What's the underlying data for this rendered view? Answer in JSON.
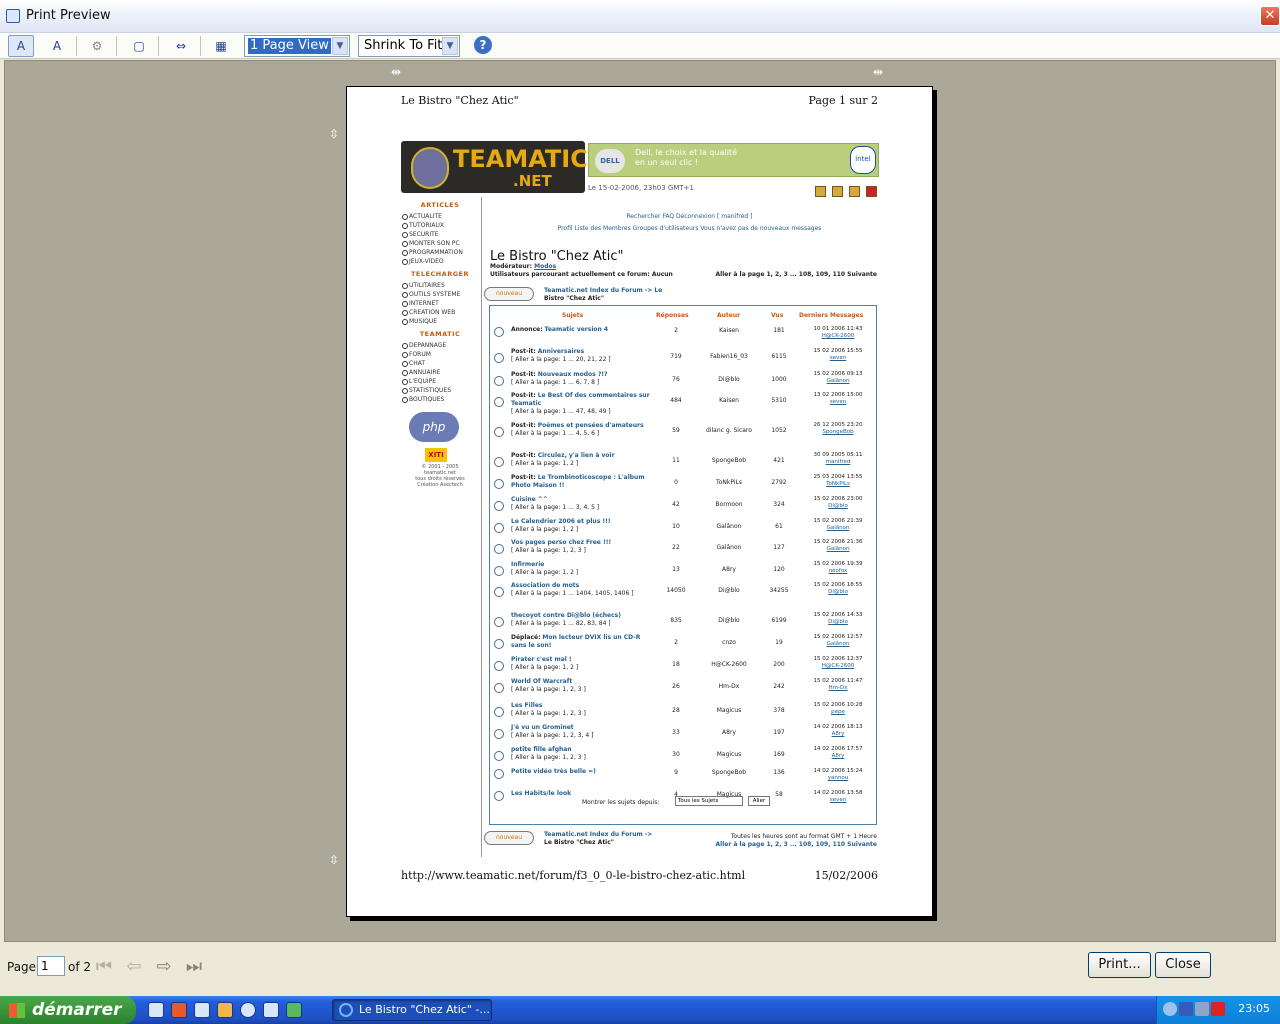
{
  "window": {
    "title": "Print Preview",
    "close_glyph": "✕"
  },
  "toolbar": {
    "view_mode": "1 Page View",
    "fit_mode": "Shrink To Fit",
    "font_a_label": "A",
    "font_b_label": "A",
    "help_label": "?"
  },
  "page": {
    "header_left": "Le Bistro \"Chez Atic\"",
    "header_right": "Page 1 sur 2",
    "footer_left": "http://www.teamatic.net/forum/f3_0_0-le-bistro-chez-atic.html",
    "footer_right": "15/02/2006"
  },
  "site": {
    "logo_text": "TEAMATIC",
    "logo_sub": ".NET",
    "banner_brand": "DELL",
    "banner_text": "Dell, le choix et la qualité en un seul clic !",
    "banner_intel": "intel",
    "date_text": "Le 15-02-2006, 23h03 GMT+1",
    "nav": [
      {
        "heading": "ARTICLES",
        "items": [
          "ACTUALITE",
          "TUTORIAUX",
          "SECURITE",
          "MONTER SON PC",
          "PROGRAMMATION",
          "JEUX-VIDEO"
        ]
      },
      {
        "heading": "TELECHARGER",
        "items": [
          "UTILITAIRES",
          "OUTILS SYSTEME",
          "INTERNET",
          "CREATION WEB",
          "MUSIQUE"
        ]
      },
      {
        "heading": "TEAMATIC",
        "items": [
          "DEPANNAGE",
          "FORUM",
          "CHAT",
          "ANNUAIRE",
          "L'EQUIPE",
          "STATISTIQUES",
          "BOUTIQUES"
        ]
      }
    ],
    "php_label": "php",
    "xiti_label": "XITI",
    "copyright": [
      "© 2001 - 2005",
      "teamatic.net",
      "tous droits réservés",
      "Création Asectech"
    ],
    "toplinks_1": "Rechercher   FAQ   Déconnexion [ manifred ]",
    "toplinks_2": "Profil   Liste des Membres   Groupes d'utilisateurs   Vous n'avez pas de nouveaux messages",
    "forum_title": "Le Bistro \"Chez Atic\"",
    "moderator_label": "Modérateur:",
    "moderator_value": "Modos",
    "users_text": "Utilisateurs parcourant actuellement ce forum: Aucun",
    "pages_text": "Aller à la page 1, 2, 3 ... 108, 109, 110  Suivante",
    "new_label": "nouveau",
    "crumb_1": "Teamatic.net Index du Forum -> Le",
    "crumb_2": "Bistro \"Chez Atic\"",
    "crumb_bottom_1": "Teamatic.net Index du Forum ->",
    "crumb_bottom_2": "Le Bistro \"Chez Atic\"",
    "columns": [
      "Sujets",
      "Réponses",
      "Auteur",
      "Vus",
      "Derniers Messages"
    ],
    "rows": [
      {
        "prefix": "Annonce:",
        "title": "Teamatic version 4",
        "pages": "",
        "replies": "2",
        "author": "Kaisen",
        "views": "181",
        "last": "10 01 2006 11:43",
        "last_user": "H@CK-2600"
      },
      {
        "prefix": "Post-it:",
        "title": "Anniversaires",
        "pages": "[ Aller à la page: 1 ... 20, 21, 22 ]",
        "replies": "719",
        "author": "Fabien16_03",
        "views": "6115",
        "last": "15 02 2006 15:55",
        "last_user": "seven"
      },
      {
        "prefix": "Post-it:",
        "title": "Nouveaux modos ?!?",
        "pages": "[ Aller à la page: 1 ... 6, 7, 8 ]",
        "replies": "76",
        "author": "Di@blo",
        "views": "1000",
        "last": "15 02 2006 09:13",
        "last_user": "Galânon"
      },
      {
        "prefix": "Post-it:",
        "title": "Le Best Of des commentaires sur Teamatic",
        "pages": "[ Aller à la page: 1 ... 47, 48, 49 ]",
        "replies": "484",
        "author": "Kaisen",
        "views": "5310",
        "last": "13 02 2006 15:00",
        "last_user": "seven"
      },
      {
        "prefix": "Post-it:",
        "title": "Poèmes et pensées d'amateurs",
        "pages": "[ Aller à la page: 1 ... 4, 5, 6 ]",
        "replies": "59",
        "author": "dilanc g. Sicaro",
        "views": "1052",
        "last": "26 12 2005 23:20",
        "last_user": "SpongeBob"
      },
      {
        "prefix": "Post-it:",
        "title": "Circulez, y'a lien à voir",
        "pages": "[ Aller à la page: 1, 2 ]",
        "replies": "11",
        "author": "SpongeBob",
        "views": "421",
        "last": "30 09 2005 05:11",
        "last_user": "manifred"
      },
      {
        "prefix": "Post-it:",
        "title": "Le Trombinoticoscope : L'album Photo Maison !!",
        "pages": "",
        "replies": "0",
        "author": "ToNkPiLs",
        "views": "2792",
        "last": "25 03 2004 13:55",
        "last_user": "ToNkPiLs"
      },
      {
        "prefix": "",
        "title": "Cuisine ^^",
        "pages": "[ Aller à la page: 1 ... 3, 4, 5 ]",
        "replies": "42",
        "author": "Bormoon",
        "views": "324",
        "last": "15 02 2006 23:00",
        "last_user": "Di@blo"
      },
      {
        "prefix": "",
        "title": "Le Calendrier 2006 et plus !!!",
        "pages": "[ Aller à la page: 1, 2 ]",
        "replies": "10",
        "author": "Galânon",
        "views": "61",
        "last": "15 02 2006 21:39",
        "last_user": "Galânon"
      },
      {
        "prefix": "",
        "title": "Vos pages perso chez Free !!!",
        "pages": "[ Aller à la page: 1, 2, 3 ]",
        "replies": "22",
        "author": "Galânon",
        "views": "127",
        "last": "15 02 2006 21:36",
        "last_user": "Galânon"
      },
      {
        "prefix": "",
        "title": "Infirmerie",
        "pages": "[ Aller à la page: 1, 2 ]",
        "replies": "13",
        "author": "A8ry",
        "views": "120",
        "last": "15 02 2006 19:39",
        "last_user": "néofox"
      },
      {
        "prefix": "",
        "title": "Association de mots",
        "pages": "[ Aller à la page: 1 ... 1404, 1405, 1406 ]",
        "replies": "14050",
        "author": "Di@blo",
        "views": "34255",
        "last": "15 02 2006 18:55",
        "last_user": "Di@blo"
      },
      {
        "prefix": "",
        "title": "thecoyot contre Di@blo (échecs)",
        "pages": "[ Aller à la page: 1 ... 82, 83, 84 ]",
        "replies": "835",
        "author": "Di@blo",
        "views": "6199",
        "last": "15 02 2006 14:33",
        "last_user": "Di@blo"
      },
      {
        "prefix": "Déplacé:",
        "title": "Mon lecteur DVIX lis un CD-R sans le son!",
        "pages": "",
        "replies": "2",
        "author": "cnzo",
        "views": "19",
        "last": "15 02 2006 12:57",
        "last_user": "Galânon"
      },
      {
        "prefix": "",
        "title": "Pirater c'est mal !",
        "pages": "[ Aller à la page: 1, 2 ]",
        "replies": "18",
        "author": "H@CK-2600",
        "views": "200",
        "last": "15 02 2006 12:37",
        "last_user": "H@CK-2600"
      },
      {
        "prefix": "",
        "title": "World Of Warcraft",
        "pages": "[ Aller à la page: 1, 2, 3 ]",
        "replies": "26",
        "author": "Hm-Dx",
        "views": "242",
        "last": "15 02 2006 11:47",
        "last_user": "Hm-Dx"
      },
      {
        "prefix": "",
        "title": "Les Filles",
        "pages": "[ Aller à la page: 1, 2, 3 ]",
        "replies": "28",
        "author": "Magicus",
        "views": "378",
        "last": "15 02 2006 10:28",
        "last_user": "pepe"
      },
      {
        "prefix": "",
        "title": "J'é vu un Grominet",
        "pages": "[ Aller à la page: 1, 2, 3, 4 ]",
        "replies": "33",
        "author": "A8ry",
        "views": "197",
        "last": "14 02 2006 18:13",
        "last_user": "A8ry"
      },
      {
        "prefix": "",
        "title": "petite fille afghan",
        "pages": "[ Aller à la page: 1, 2, 3 ]",
        "replies": "30",
        "author": "Magicus",
        "views": "169",
        "last": "14 02 2006 17:57",
        "last_user": "A8ry"
      },
      {
        "prefix": "",
        "title": "Petite vidéo très belle =)",
        "pages": "",
        "replies": "9",
        "author": "SpongeBob",
        "views": "136",
        "last": "14 02 2006 15:24",
        "last_user": "yannou"
      },
      {
        "prefix": "",
        "title": "Les Habits/le look",
        "pages": "",
        "replies": "4",
        "author": "Magicus",
        "views": "58",
        "last": "14 02 2006 13:58",
        "last_user": "seven"
      }
    ],
    "show_topics_label": "Montrer les sujets depuis:",
    "show_topics_value": "Tous les Sujets",
    "go_label": "Aller",
    "tz_text": "Toutes les heures sont au format GMT + 1 Heure",
    "pages_bottom": "Aller à la page 1, 2, 3 ... 108, 109, 110  Suivante"
  },
  "statusbar": {
    "page_label": "Page",
    "page_value": "1",
    "of_label": "of 2",
    "print_label": "Print...",
    "close_label": "Close"
  },
  "taskbar": {
    "start_label": "démarrer",
    "task_label": "Le Bistro \"Chez Atic\" -...",
    "clock": "23:05"
  }
}
